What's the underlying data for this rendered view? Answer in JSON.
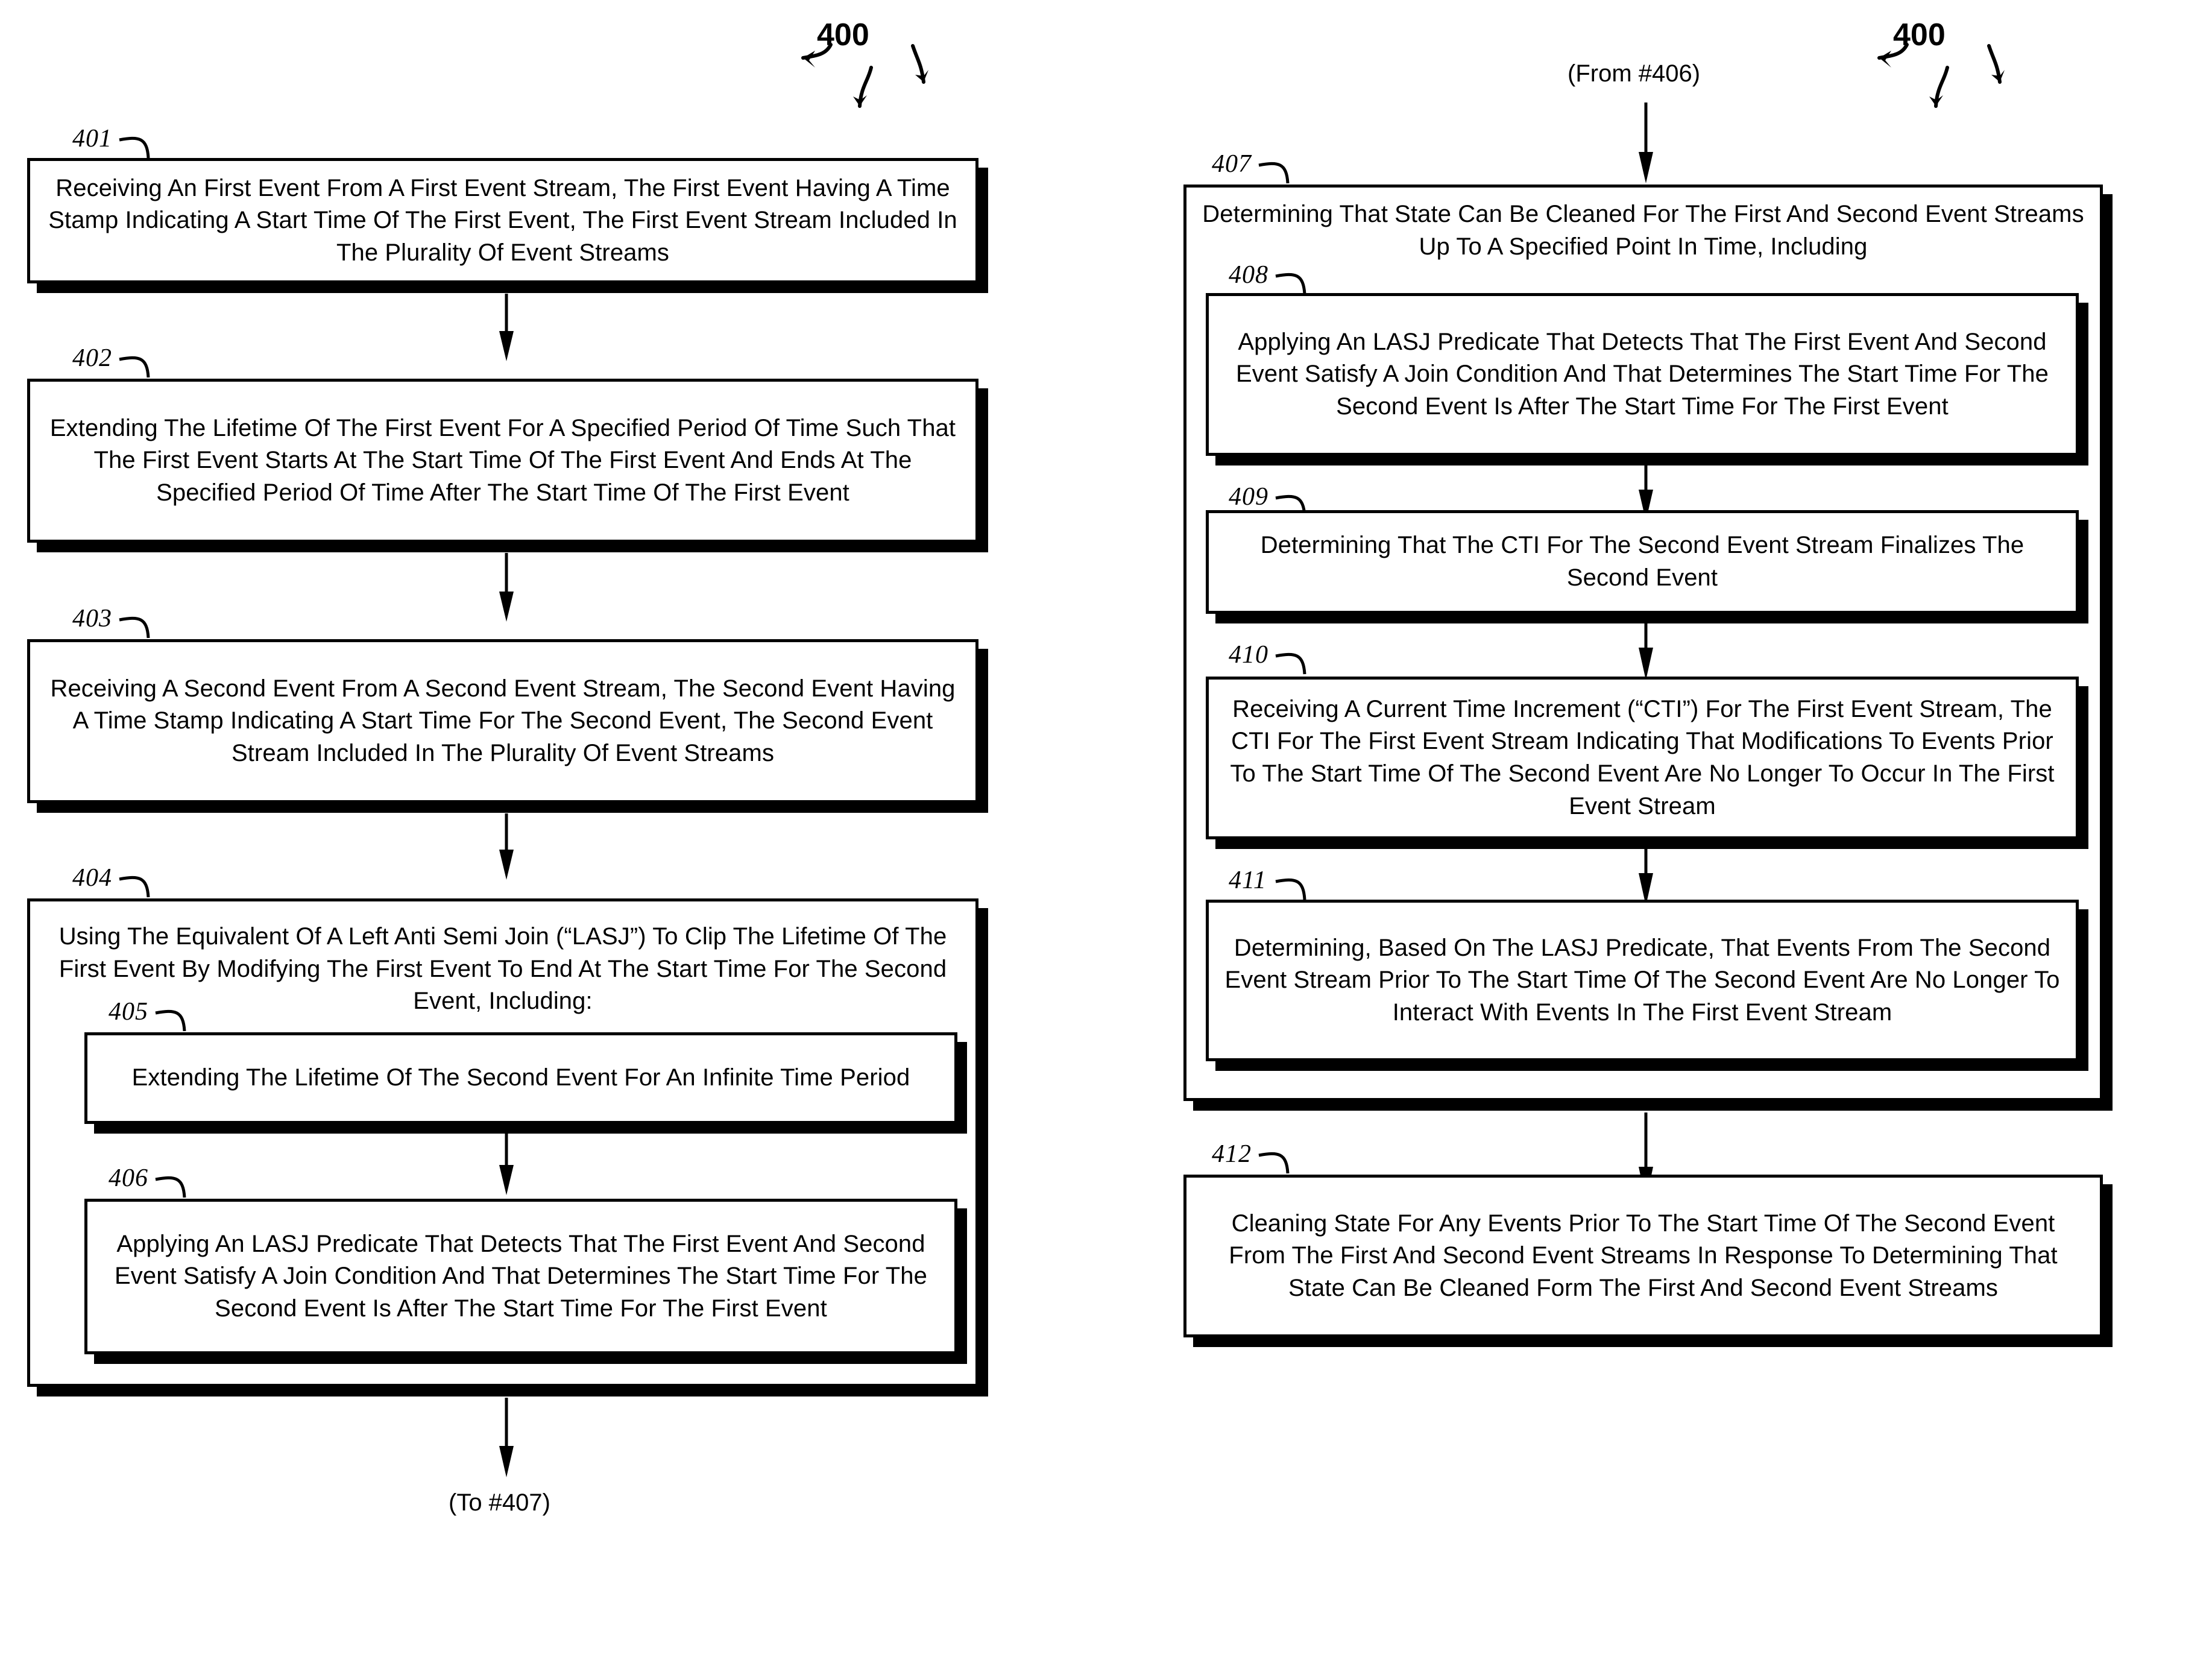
{
  "figure": {
    "number_left": "400",
    "number_right": "400"
  },
  "connectors": {
    "to_label": "(To #407)",
    "from_label": "(From #406)"
  },
  "left_column": {
    "steps": [
      {
        "ref": "401",
        "text": "Receiving An First Event From A First Event Stream, The First Event Having A Time Stamp Indicating A Start Time Of The First Event, The First Event Stream Included In The Plurality Of Event Streams"
      },
      {
        "ref": "402",
        "text": "Extending The Lifetime Of The First Event For A Specified Period Of Time Such That The First Event Starts At The Start Time Of The First Event And Ends At The Specified Period Of Time After The Start Time Of The First Event"
      },
      {
        "ref": "403",
        "text": "Receiving A Second Event From A Second Event Stream, The Second Event Having A Time Stamp Indicating A Start Time For The Second Event, The Second Event Stream Included In The Plurality Of Event Streams"
      },
      {
        "ref": "404",
        "text": "Using The Equivalent Of A Left Anti Semi Join (“LASJ”) To Clip The Lifetime Of The First Event By Modifying The First Event To End At The Start Time For The Second Event, Including:"
      },
      {
        "ref": "405",
        "text": "Extending The Lifetime Of The Second Event For An Infinite Time Period"
      },
      {
        "ref": "406",
        "text": "Applying An LASJ Predicate That Detects That The First Event And Second Event Satisfy A Join Condition And That Determines The Start Time For The Second Event Is After The Start Time For The First Event"
      }
    ]
  },
  "right_column": {
    "steps": [
      {
        "ref": "407",
        "text": "Determining That State Can Be Cleaned For The First And Second Event Streams Up To A Specified Point In Time, Including"
      },
      {
        "ref": "408",
        "text": "Applying An LASJ Predicate That Detects That The First Event And Second Event Satisfy A Join Condition And That Determines The Start Time For The Second Event Is After The Start Time For The First Event"
      },
      {
        "ref": "409",
        "text": "Determining That The CTI For The Second Event Stream Finalizes The Second Event"
      },
      {
        "ref": "410",
        "text": "Receiving A Current Time Increment (“CTI”) For The First Event Stream, The CTI For The First Event Stream Indicating That Modifications To Events Prior To The Start Time Of The Second Event Are No Longer To Occur In The First Event Stream"
      },
      {
        "ref": "411",
        "text": "Determining, Based On The LASJ Predicate, That Events From The Second Event Stream Prior To The Start Time Of The Second Event Are No Longer To Interact With Events In The First Event Stream"
      },
      {
        "ref": "412",
        "text": "Cleaning State For Any Events Prior To The Start Time Of The Second Event From The First And Second Event Streams In Response To Determining That State Can Be Cleaned Form The First And Second Event Streams"
      }
    ]
  }
}
